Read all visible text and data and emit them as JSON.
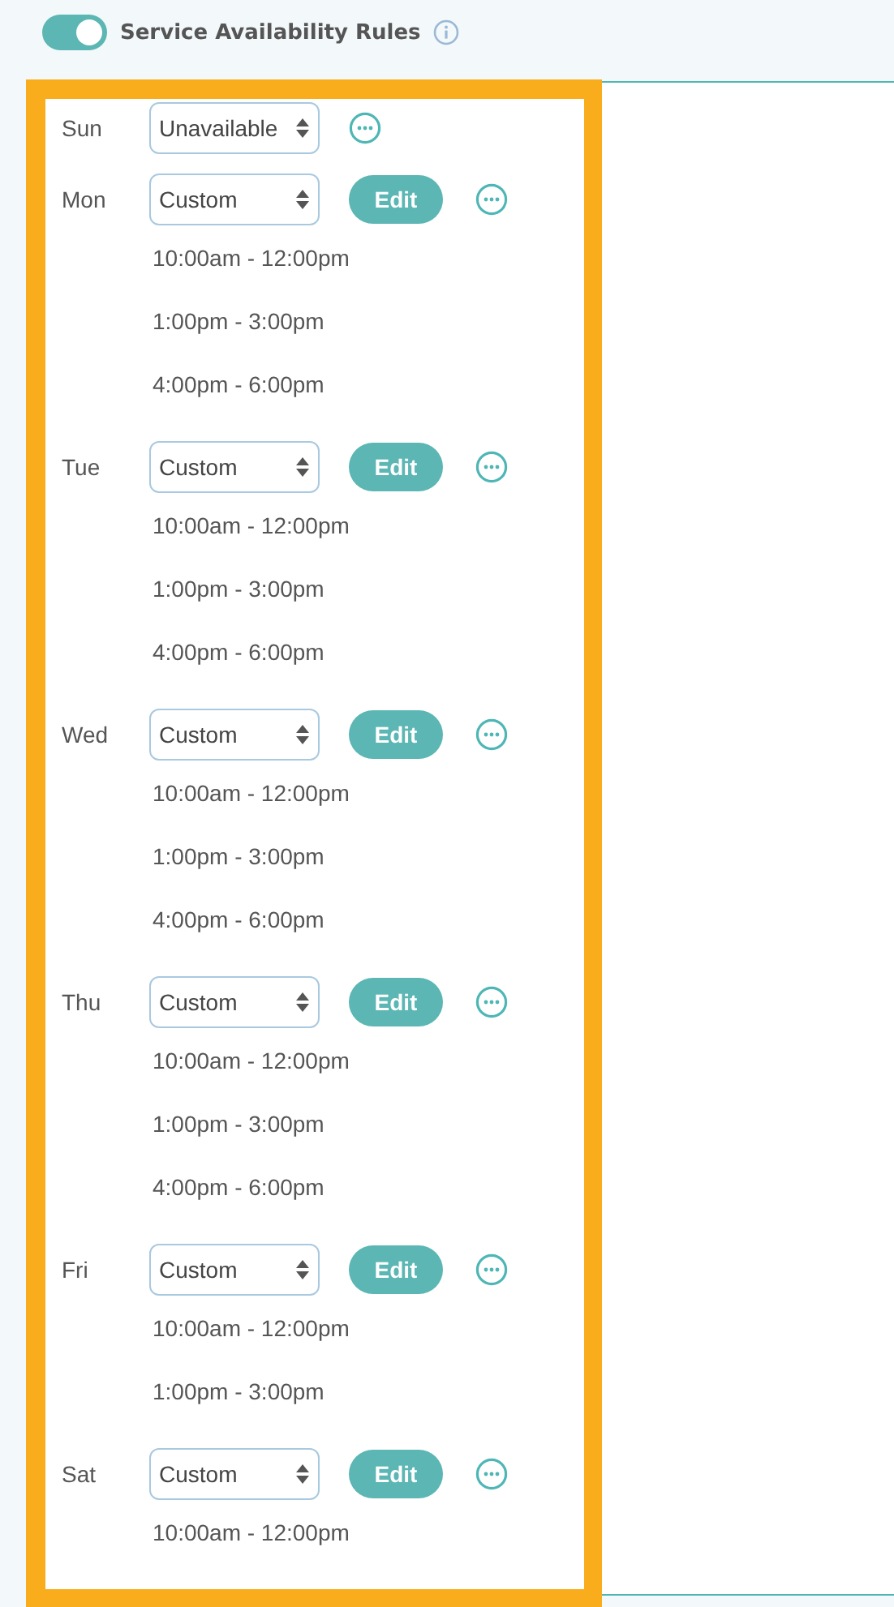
{
  "header": {
    "toggle_on": true,
    "title": "Service Availability Rules"
  },
  "days": [
    {
      "day": "Sun",
      "mode": "Unavailable"
    },
    {
      "day": "Mon",
      "mode": "Custom",
      "edit": "Edit",
      "times": [
        "10:00am - 12:00pm",
        "1:00pm - 3:00pm",
        "4:00pm - 6:00pm"
      ]
    },
    {
      "day": "Tue",
      "mode": "Custom",
      "edit": "Edit",
      "times": [
        "10:00am - 12:00pm",
        "1:00pm - 3:00pm",
        "4:00pm - 6:00pm"
      ]
    },
    {
      "day": "Wed",
      "mode": "Custom",
      "edit": "Edit",
      "times": [
        "10:00am - 12:00pm",
        "1:00pm - 3:00pm",
        "4:00pm - 6:00pm"
      ]
    },
    {
      "day": "Thu",
      "mode": "Custom",
      "edit": "Edit",
      "times": [
        "10:00am - 12:00pm",
        "1:00pm - 3:00pm",
        "4:00pm - 6:00pm"
      ]
    },
    {
      "day": "Fri",
      "mode": "Custom",
      "edit": "Edit",
      "times": [
        "10:00am - 12:00pm",
        "1:00pm - 3:00pm"
      ]
    },
    {
      "day": "Sat",
      "mode": "Custom",
      "edit": "Edit",
      "times": [
        "10:00am - 12:00pm"
      ]
    }
  ]
}
